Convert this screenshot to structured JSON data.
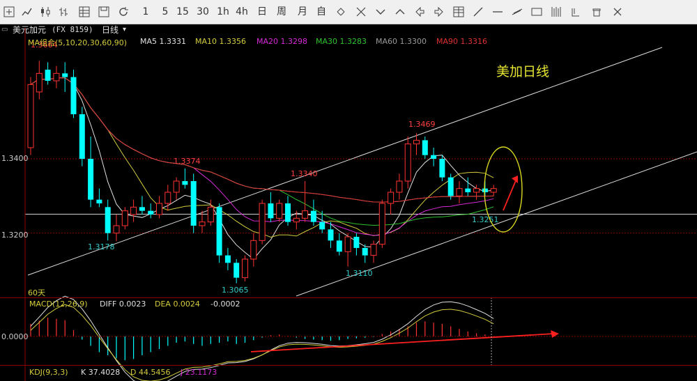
{
  "toolbar": {
    "items": [
      {
        "name": "crosshair-tool-icon",
        "text": ""
      },
      {
        "name": "line-chart-icon",
        "text": ""
      },
      {
        "name": "candlestick-icon",
        "text": ""
      },
      {
        "name": "ohlc-bar-icon",
        "text": ""
      },
      {
        "name": "indicator-grid-icon",
        "text": ""
      },
      {
        "name": "save-layout-icon",
        "text": ""
      },
      {
        "name": "refresh-icon",
        "text": ""
      },
      {
        "name": "period-1m",
        "text": "1"
      },
      {
        "name": "period-5m",
        "text": "5"
      },
      {
        "name": "period-15m",
        "text": "15"
      },
      {
        "name": "period-30m",
        "text": "30"
      },
      {
        "name": "period-1h",
        "text": "1h"
      },
      {
        "name": "period-4h",
        "text": "4h"
      },
      {
        "name": "period-day",
        "text": "日"
      },
      {
        "name": "period-week",
        "text": "周"
      },
      {
        "name": "period-month",
        "text": "月"
      },
      {
        "name": "period-custom",
        "text": "自"
      },
      {
        "name": "zoom-in-icon",
        "text": ""
      },
      {
        "name": "zoom-out-icon",
        "text": ""
      },
      {
        "name": "scroll-down-icon",
        "text": ""
      },
      {
        "name": "scroll-up-icon",
        "text": ""
      },
      {
        "name": "scroll-left-icon",
        "text": ""
      },
      {
        "name": "scroll-right-icon",
        "text": ""
      },
      {
        "name": "table-view-icon",
        "text": ""
      },
      {
        "name": "trend-line-icon",
        "text": ""
      },
      {
        "name": "horizontal-line-icon",
        "text": ""
      },
      {
        "name": "parallel-line-icon",
        "text": ""
      },
      {
        "name": "rectangle-icon",
        "text": ""
      },
      {
        "name": "fibonacci-icon",
        "text": ""
      },
      {
        "name": "gann-icon",
        "text": ""
      },
      {
        "name": "delete-drawing-icon",
        "text": ""
      },
      {
        "name": "close-icon",
        "text": ""
      }
    ]
  },
  "header": {
    "symbol": "美元加元",
    "code": "(FX 8159)",
    "period": "日线",
    "period_caret": "▾"
  },
  "legend": {
    "ma_group": "MA组合(5,10,20,30,60,90)",
    "items": [
      {
        "label": "MA5 1.3331",
        "color": "#e0e0e0"
      },
      {
        "label": "MA10 1.3356",
        "color": "#d4cc3c"
      },
      {
        "label": "MA20 1.3298",
        "color": "#d62ad6"
      },
      {
        "label": "MA30 1.3283",
        "color": "#2ec32e"
      },
      {
        "label": "MA60 1.3300",
        "color": "#9a9a9a"
      },
      {
        "label": "MA90 1.3316",
        "color": "#e03030"
      }
    ]
  },
  "annotation_title": "美加日线",
  "price_labels": [
    {
      "text": "1.3664",
      "color": "#ff4040"
    },
    {
      "text": "1.3374",
      "color": "#ff4040"
    },
    {
      "text": "1.3340",
      "color": "#ff4040"
    },
    {
      "text": "1.3469",
      "color": "#ff4040"
    },
    {
      "text": "1.3178",
      "color": "#33cccc"
    },
    {
      "text": "1.3065",
      "color": "#33cccc"
    },
    {
      "text": "1.3110",
      "color": "#33cccc"
    },
    {
      "text": "1.3251",
      "color": "#33cccc"
    }
  ],
  "y_axis": {
    "ticks": [
      "1.3400",
      "1.3200"
    ]
  },
  "days_label": "60天",
  "macd": {
    "title": "MACD(12,26,9)",
    "diff": "DIFF 0.0023",
    "dea": "DEA 0.0024",
    "hist": "-0.0002",
    "zero_tick": "0.0000"
  },
  "kdj": {
    "title": "KDJ(9,3,3)",
    "k": "K 37.4028",
    "d": "D 44.5456",
    "j": "J 23.1173"
  },
  "colors": {
    "up": "#ff3232",
    "down": "#00ffff",
    "grid_separator": "#8b0000",
    "annotation": "#e6e632",
    "arrow": "#ff2020"
  },
  "chart_data": {
    "type": "candlestick",
    "candles": [
      [
        1.343,
        1.362,
        1.341,
        1.36
      ],
      [
        1.358,
        1.3664,
        1.356,
        1.363
      ],
      [
        1.364,
        1.366,
        1.36,
        1.361
      ],
      [
        1.361,
        1.365,
        1.359,
        1.363
      ],
      [
        1.363,
        1.366,
        1.358,
        1.362
      ],
      [
        1.362,
        1.364,
        1.351,
        1.352
      ],
      [
        1.352,
        1.354,
        1.338,
        1.34
      ],
      [
        1.34,
        1.346,
        1.327,
        1.329
      ],
      [
        1.329,
        1.332,
        1.327,
        1.328
      ],
      [
        1.327,
        1.329,
        1.318,
        1.32
      ],
      [
        1.32,
        1.325,
        1.3178,
        1.322
      ],
      [
        1.322,
        1.327,
        1.321,
        1.326
      ],
      [
        1.325,
        1.329,
        1.323,
        1.327
      ],
      [
        1.327,
        1.33,
        1.325,
        1.326
      ],
      [
        1.326,
        1.328,
        1.324,
        1.325
      ],
      [
        1.325,
        1.33,
        1.324,
        1.328
      ],
      [
        1.328,
        1.333,
        1.326,
        1.331
      ],
      [
        1.331,
        1.335,
        1.329,
        1.334
      ],
      [
        1.334,
        1.3374,
        1.332,
        1.333
      ],
      [
        1.334,
        1.336,
        1.32,
        1.322
      ],
      [
        1.322,
        1.326,
        1.32,
        1.323
      ],
      [
        1.323,
        1.329,
        1.322,
        1.327
      ],
      [
        1.327,
        1.328,
        1.312,
        1.314
      ],
      [
        1.314,
        1.316,
        1.31,
        1.312
      ],
      [
        1.312,
        1.313,
        1.3065,
        1.308
      ],
      [
        1.308,
        1.314,
        1.307,
        1.313
      ],
      [
        1.313,
        1.32,
        1.311,
        1.318
      ],
      [
        1.318,
        1.329,
        1.317,
        1.328
      ],
      [
        1.328,
        1.331,
        1.323,
        1.324
      ],
      [
        1.324,
        1.329,
        1.323,
        1.328
      ],
      [
        1.328,
        1.33,
        1.322,
        1.323
      ],
      [
        1.323,
        1.326,
        1.321,
        1.324
      ],
      [
        1.324,
        1.334,
        1.323,
        1.326
      ],
      [
        1.326,
        1.329,
        1.322,
        1.323
      ],
      [
        1.323,
        1.326,
        1.32,
        1.321
      ],
      [
        1.321,
        1.323,
        1.316,
        1.318
      ],
      [
        1.318,
        1.32,
        1.314,
        1.315
      ],
      [
        1.315,
        1.32,
        1.311,
        1.319
      ],
      [
        1.319,
        1.32,
        1.314,
        1.316
      ],
      [
        1.316,
        1.317,
        1.312,
        1.314
      ],
      [
        1.314,
        1.318,
        1.312,
        1.317
      ],
      [
        1.317,
        1.329,
        1.316,
        1.328
      ],
      [
        1.328,
        1.332,
        1.325,
        1.331
      ],
      [
        1.331,
        1.336,
        1.329,
        1.334
      ],
      [
        1.334,
        1.346,
        1.332,
        1.344
      ],
      [
        1.344,
        1.3469,
        1.341,
        1.345
      ],
      [
        1.345,
        1.346,
        1.34,
        1.341
      ],
      [
        1.341,
        1.343,
        1.338,
        1.34
      ],
      [
        1.34,
        1.341,
        1.334,
        1.335
      ],
      [
        1.335,
        1.336,
        1.329,
        1.33
      ],
      [
        1.33,
        1.334,
        1.328,
        1.332
      ],
      [
        1.332,
        1.335,
        1.33,
        1.331
      ],
      [
        1.331,
        1.333,
        1.329,
        1.332
      ],
      [
        1.332,
        1.334,
        1.33,
        1.331
      ],
      [
        1.331,
        1.333,
        1.33,
        1.332
      ]
    ],
    "ylim": [
      1.304,
      1.37
    ],
    "hlines": [
      1.34,
      1.32,
      1.3251
    ],
    "macd_hist": [
      0.002,
      0.0025,
      0.003,
      0.0028,
      0.0026,
      0.001,
      -0.0005,
      -0.0015,
      -0.0025,
      -0.003,
      -0.0035,
      -0.0038,
      -0.0036,
      -0.003,
      -0.0025,
      -0.002,
      -0.0015,
      -0.001,
      -0.0008,
      -0.0012,
      -0.0015,
      -0.0012,
      -0.001,
      -0.0008,
      -0.0012,
      -0.001,
      -0.0006,
      -0.0002,
      0.0002,
      0.0003,
      0.0001,
      -0.0002,
      -0.0004,
      -0.0005,
      -0.0006,
      -0.0007,
      -0.0006,
      -0.0004,
      -0.0003,
      -0.0002,
      -0.0001,
      0.0004,
      0.0008,
      0.0012,
      0.0016,
      0.0022,
      0.0024,
      0.0022,
      0.002,
      0.0016,
      0.0012,
      0.0008,
      0.0005,
      0.0003,
      -0.0002
    ]
  }
}
